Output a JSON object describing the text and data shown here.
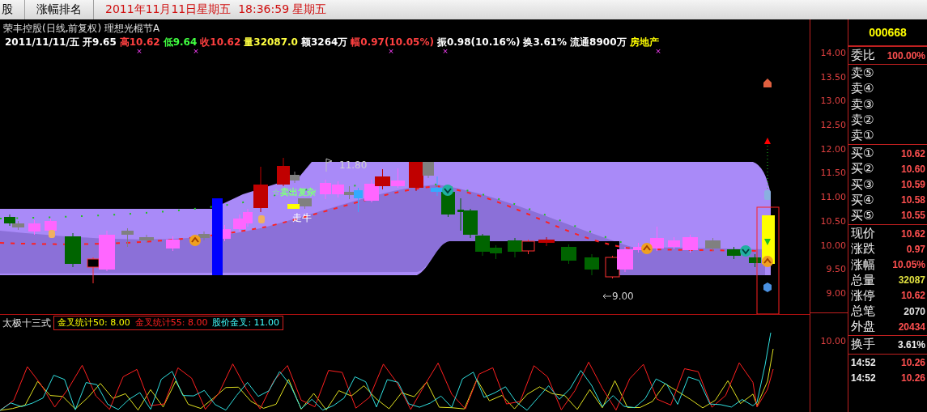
{
  "tabs": [
    {
      "label": "股",
      "selected": false
    },
    {
      "label": "涨幅排名",
      "selected": false
    }
  ],
  "clock": "2011年11月11日星期五  18:36:59 星期五",
  "chart": {
    "title": "荣丰控股(日线,前复权) 理想光棍节A",
    "quote": [
      {
        "text": "2011/11/11/五 开9.65",
        "color": "#ffffff"
      },
      {
        "text": "高10.62",
        "color": "#ff4040"
      },
      {
        "text": "低9.64",
        "color": "#40ff40"
      },
      {
        "text": "收10.62",
        "color": "#ff4040"
      },
      {
        "text": "量32087.0",
        "color": "#ffff40"
      },
      {
        "text": "额3264万",
        "color": "#ffffff"
      },
      {
        "text": "幅0.97(10.05%)",
        "color": "#ff4040"
      },
      {
        "text": "振0.98(10.16%)",
        "color": "#ffffff"
      },
      {
        "text": "换3.61%",
        "color": "#ffffff"
      },
      {
        "text": "流通8900万",
        "color": "#ffffff"
      },
      {
        "text": "房地产",
        "color": "#ffff00"
      }
    ],
    "markers": [
      "×",
      "×",
      "×",
      "×",
      "×"
    ],
    "annotations": [
      {
        "kind": "high",
        "text": "11.80"
      },
      {
        "kind": "signal",
        "text": "☆卖出复杂"
      },
      {
        "kind": "label",
        "text": "走牛"
      },
      {
        "kind": "low",
        "text": "9.00"
      }
    ],
    "price_axis": [
      "14.00",
      "13.50",
      "13.00",
      "12.50",
      "12.00",
      "11.50",
      "11.00",
      "10.50",
      "10.00",
      "9.50",
      "9.00"
    ]
  },
  "indicator": {
    "name": "太极十三式",
    "legend": [
      {
        "text": "金叉统计50: 8.00",
        "color": "#ffff00"
      },
      {
        "text": "金叉统计55: 8.00",
        "color": "#ff2020"
      },
      {
        "text": "股价金叉: 11.00",
        "color": "#40ffff"
      }
    ],
    "axis": [
      "10.00"
    ]
  },
  "quote_panel": {
    "code": "000668",
    "ratio": {
      "label": "委比",
      "value": "100.00%"
    },
    "sell": [
      {
        "label": "卖⑤"
      },
      {
        "label": "卖④"
      },
      {
        "label": "卖③"
      },
      {
        "label": "卖②"
      },
      {
        "label": "卖①"
      }
    ],
    "buy": [
      {
        "label": "买①",
        "value": "10.62"
      },
      {
        "label": "买②",
        "value": "10.60"
      },
      {
        "label": "买③",
        "value": "10.59"
      },
      {
        "label": "买④",
        "value": "10.58"
      },
      {
        "label": "买⑤",
        "value": "10.55"
      }
    ],
    "stats": [
      {
        "label": "现价",
        "value": "10.62",
        "color": "#ff5050"
      },
      {
        "label": "涨跌",
        "value": "0.97",
        "color": "#ff5050"
      },
      {
        "label": "涨幅",
        "value": "10.05%",
        "color": "#ff5050"
      },
      {
        "label": "总量",
        "value": "32087",
        "color": "#e0e040"
      },
      {
        "label": "涨停",
        "value": "10.62",
        "color": "#ff5050"
      },
      {
        "label": "总笔",
        "value": "2070",
        "color": "#e0e0e0"
      },
      {
        "label": "外盘",
        "value": "20434",
        "color": "#ff5050"
      }
    ],
    "turnover": {
      "label": "换手",
      "value": "3.61%"
    },
    "ticks": [
      {
        "time": "14:52",
        "price": "10.26"
      },
      {
        "time": "14:52",
        "price": "10.26"
      }
    ]
  }
}
